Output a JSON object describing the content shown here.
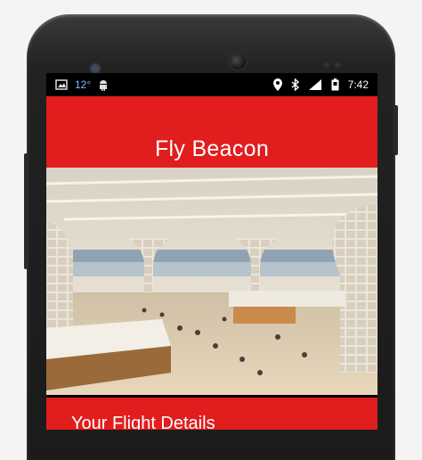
{
  "status_bar": {
    "temperature": "12°",
    "time": "7:42",
    "icons": [
      "image-icon",
      "android-icon",
      "location-icon",
      "bluetooth-icon",
      "signal-icon",
      "battery-icon"
    ]
  },
  "app": {
    "title": "Fly Beacon",
    "section_title": "Your Flight Details",
    "accent_color": "#e21d1d"
  },
  "hero_image": {
    "subject": "airport-terminal-interior"
  }
}
